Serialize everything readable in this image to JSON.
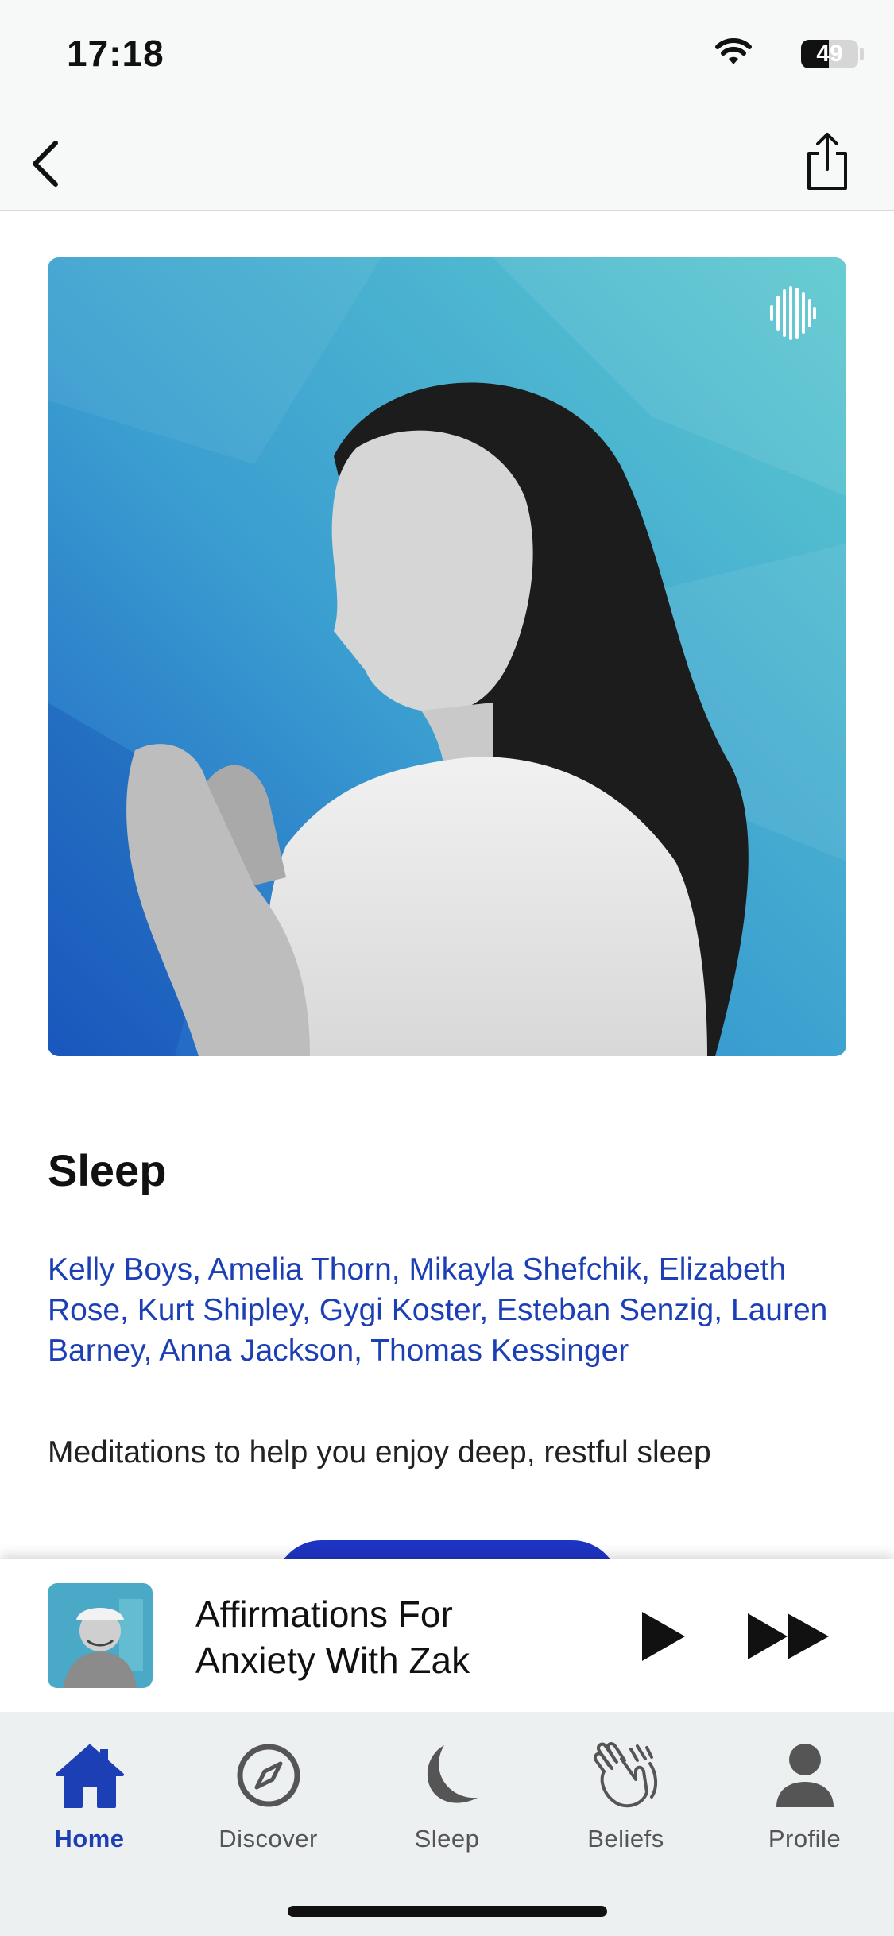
{
  "status_bar": {
    "time": "17:18",
    "battery": "49",
    "battery_level": 0.49
  },
  "nav": {
    "back_icon": "chevron-left-icon",
    "share_icon": "share-icon"
  },
  "course": {
    "title": "Sleep",
    "authors": "Kelly Boys, Amelia Thorn, Mikayla Shefchik, Elizabeth Rose, Kurt Shipley, Gygi Koster, Esteban Senzig, Lauren Barney, Anna Jackson, Thomas Kessinger",
    "description": "Meditations to help you enjoy deep, restful sleep",
    "cover_icon": "waveform-logo-icon"
  },
  "mini_player": {
    "title": "Affirmations For Anxiety With Zak",
    "play_icon": "play-icon",
    "forward_icon": "fast-forward-icon"
  },
  "tabs": [
    {
      "label": "Home",
      "icon": "home-icon",
      "active": true
    },
    {
      "label": "Discover",
      "icon": "compass-icon",
      "active": false
    },
    {
      "label": "Sleep",
      "icon": "moon-icon",
      "active": false
    },
    {
      "label": "Beliefs",
      "icon": "clapping-hands-icon",
      "active": false
    },
    {
      "label": "Profile",
      "icon": "person-icon",
      "active": false
    }
  ],
  "colors": {
    "accent": "#1d3fb6",
    "cta": "#1e35c4",
    "text": "#111111",
    "tab_bg": "#ecf0f1"
  }
}
